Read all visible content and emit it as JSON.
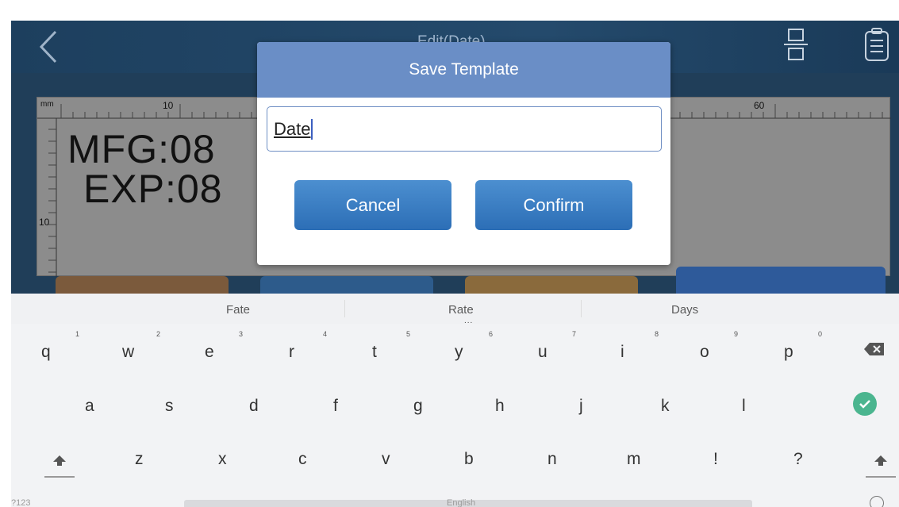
{
  "header": {
    "title": "Edit(Date)"
  },
  "canvas": {
    "ruler_unit": "mm",
    "ruler_labels": {
      "mark_10": "10",
      "mark_60": "60",
      "vertical_10": "10"
    },
    "line1": "MFG:08",
    "line2": "EXP:08"
  },
  "dialog": {
    "title": "Save Template",
    "input_value": "Date",
    "cancel_label": "Cancel",
    "confirm_label": "Confirm"
  },
  "keyboard": {
    "suggestions": [
      "Fate",
      "Rate",
      "Days"
    ],
    "suggestion_dots": "...",
    "row1": [
      "q",
      "w",
      "e",
      "r",
      "t",
      "y",
      "u",
      "i",
      "o",
      "p"
    ],
    "row1_hints": [
      "1",
      "2",
      "3",
      "4",
      "5",
      "6",
      "7",
      "8",
      "9",
      "0"
    ],
    "row2": [
      "a",
      "s",
      "d",
      "f",
      "g",
      "h",
      "j",
      "k",
      "l"
    ],
    "row3": [
      "z",
      "x",
      "c",
      "v",
      "b",
      "n",
      "m",
      "!",
      "?"
    ],
    "numbers_label": "?123",
    "space_label": "English"
  },
  "colors": {
    "dialog_header": "#6a8ec6",
    "button_blue": "#2c6eb6",
    "checkmark_green": "#4bb58f",
    "app_background": "#1e3e58"
  }
}
